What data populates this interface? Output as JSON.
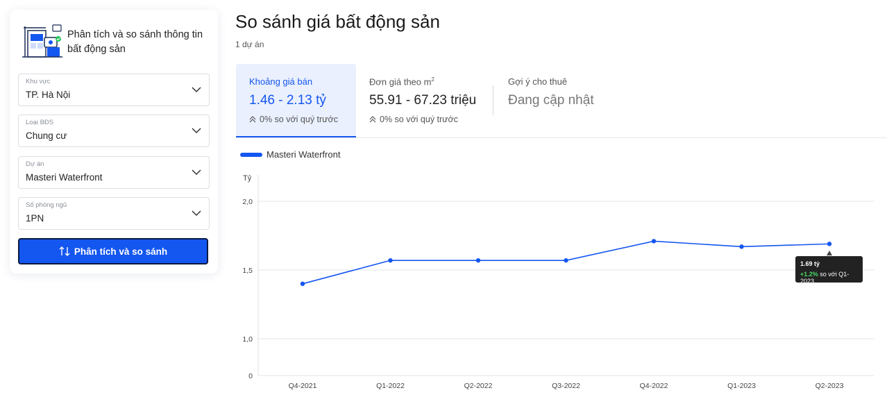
{
  "sidebar": {
    "title": "Phân tích và so sánh thông tin bất động sản",
    "fields": [
      {
        "label": "Khu vực",
        "value": "TP. Hà Nội"
      },
      {
        "label": "Loại BĐS",
        "value": "Chung cư"
      },
      {
        "label": "Dự án",
        "value": "Masteri Waterfront"
      },
      {
        "label": "Số phòng ngủ",
        "value": "1PN"
      }
    ],
    "submit_label": "Phân tích và so sánh"
  },
  "header": {
    "title": "So sánh giá bất động sản",
    "subtitle": "1 dự án"
  },
  "tabs": [
    {
      "label": "Khoảng giá bán",
      "value": "1.46 - 2.13 tỷ",
      "change": "0% so với quý trước"
    },
    {
      "label": "Đơn giá theo m",
      "label_sup": "2",
      "value": "55.91 - 67.23 triệu",
      "change": "0% so với quý trước"
    },
    {
      "label": "Gợi ý cho thuê",
      "value": "Đang cập nhật"
    }
  ],
  "colors": {
    "accent": "#1456f0",
    "positive": "#4cd964"
  },
  "tooltip": {
    "value": "1.69 tỷ",
    "change": "+1.2%",
    "compare": " so với Q1-2023"
  },
  "chart_data": {
    "type": "line",
    "ylabel": "Tỷ",
    "categories": [
      "Q4-2021",
      "Q1-2022",
      "Q2-2022",
      "Q3-2022",
      "Q4-2022",
      "Q1-2023",
      "Q2-2023"
    ],
    "series": [
      {
        "name": "Masteri Waterfront",
        "values": [
          1.4,
          1.57,
          1.57,
          1.57,
          1.71,
          1.67,
          1.69
        ]
      }
    ],
    "y_ticks": [
      {
        "label": "2,0",
        "value": 2.0
      },
      {
        "label": "1,5",
        "value": 1.5
      },
      {
        "label": "1,0",
        "value": 1.0
      },
      {
        "label": "0",
        "value": 0
      }
    ],
    "ylim": [
      0,
      2.0
    ],
    "grid": true,
    "legend": "top-left"
  }
}
